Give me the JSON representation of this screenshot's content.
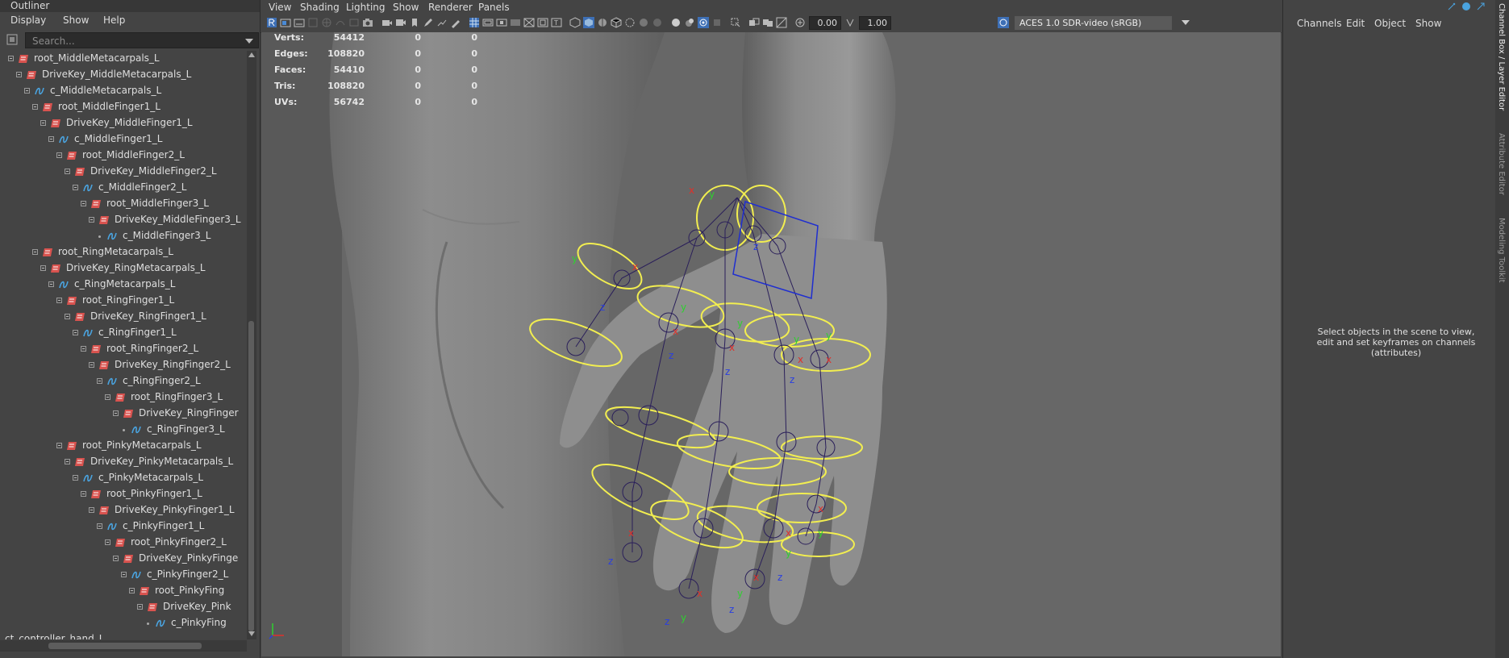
{
  "outliner": {
    "title": "Outliner",
    "menu": [
      "Display",
      "Show",
      "Help"
    ],
    "search_placeholder": "Search...",
    "rows": [
      {
        "label": "root_MiddleMetacarpals_L",
        "indent": 0,
        "type": "root"
      },
      {
        "label": "DriveKey_MiddleMetacarpals_L",
        "indent": 1,
        "type": "root"
      },
      {
        "label": "c_MiddleMetacarpals_L",
        "indent": 2,
        "type": "curve"
      },
      {
        "label": "root_MiddleFinger1_L",
        "indent": 3,
        "type": "root"
      },
      {
        "label": "DriveKey_MiddleFinger1_L",
        "indent": 4,
        "type": "root"
      },
      {
        "label": "c_MiddleFinger1_L",
        "indent": 5,
        "type": "curve"
      },
      {
        "label": "root_MiddleFinger2_L",
        "indent": 6,
        "type": "root"
      },
      {
        "label": "DriveKey_MiddleFinger2_L",
        "indent": 7,
        "type": "root"
      },
      {
        "label": "c_MiddleFinger2_L",
        "indent": 8,
        "type": "curve"
      },
      {
        "label": "root_MiddleFinger3_L",
        "indent": 9,
        "type": "root"
      },
      {
        "label": "DriveKey_MiddleFinger3_L",
        "indent": 10,
        "type": "root"
      },
      {
        "label": "c_MiddleFinger3_L",
        "indent": 11,
        "type": "curve",
        "leaf": true
      },
      {
        "label": "root_RingMetacarpals_L",
        "indent": 3,
        "type": "root"
      },
      {
        "label": "DriveKey_RingMetacarpals_L",
        "indent": 4,
        "type": "root"
      },
      {
        "label": "c_RingMetacarpals_L",
        "indent": 5,
        "type": "curve"
      },
      {
        "label": "root_RingFinger1_L",
        "indent": 6,
        "type": "root"
      },
      {
        "label": "DriveKey_RingFinger1_L",
        "indent": 7,
        "type": "root"
      },
      {
        "label": "c_RingFinger1_L",
        "indent": 8,
        "type": "curve"
      },
      {
        "label": "root_RingFinger2_L",
        "indent": 9,
        "type": "root"
      },
      {
        "label": "DriveKey_RingFinger2_L",
        "indent": 10,
        "type": "root"
      },
      {
        "label": "c_RingFinger2_L",
        "indent": 11,
        "type": "curve"
      },
      {
        "label": "root_RingFinger3_L",
        "indent": 12,
        "type": "root"
      },
      {
        "label": "DriveKey_RingFinger",
        "indent": 13,
        "type": "root"
      },
      {
        "label": "c_RingFinger3_L",
        "indent": 14,
        "type": "curve",
        "leaf": true
      },
      {
        "label": "root_PinkyMetacarpals_L",
        "indent": 6,
        "type": "root"
      },
      {
        "label": "DriveKey_PinkyMetacarpals_L",
        "indent": 7,
        "type": "root"
      },
      {
        "label": "c_PinkyMetacarpals_L",
        "indent": 8,
        "type": "curve"
      },
      {
        "label": "root_PinkyFinger1_L",
        "indent": 9,
        "type": "root"
      },
      {
        "label": "DriveKey_PinkyFinger1_L",
        "indent": 10,
        "type": "root"
      },
      {
        "label": "c_PinkyFinger1_L",
        "indent": 11,
        "type": "curve"
      },
      {
        "label": "root_PinkyFinger2_L",
        "indent": 12,
        "type": "root"
      },
      {
        "label": "DriveKey_PinkyFinge",
        "indent": 13,
        "type": "root"
      },
      {
        "label": "c_PinkyFinger2_L",
        "indent": 14,
        "type": "curve"
      },
      {
        "label": "root_PinkyFing",
        "indent": 15,
        "type": "root"
      },
      {
        "label": "DriveKey_Pink",
        "indent": 16,
        "type": "root"
      },
      {
        "label": "c_PinkyFing",
        "indent": 17,
        "type": "curve",
        "leaf": true
      },
      {
        "label": "ct_controller_hand_L",
        "indent": 0,
        "type": "none"
      }
    ]
  },
  "viewport": {
    "menu": [
      "View",
      "Shading",
      "Lighting",
      "Show",
      "Renderer",
      "Panels"
    ],
    "exposure": "0.00",
    "gamma": "1.00",
    "color_space": "ACES 1.0 SDR-video (sRGB)",
    "hud": [
      {
        "label": "Verts:",
        "v1": "54412",
        "v2": "0",
        "v3": "0"
      },
      {
        "label": "Edges:",
        "v1": "108820",
        "v2": "0",
        "v3": "0"
      },
      {
        "label": "Faces:",
        "v1": "54410",
        "v2": "0",
        "v3": "0"
      },
      {
        "label": "Tris:",
        "v1": "108820",
        "v2": "0",
        "v3": "0"
      },
      {
        "label": "UVs:",
        "v1": "56742",
        "v2": "0",
        "v3": "0"
      }
    ],
    "axis_labels": {
      "x": "x",
      "y": "y",
      "z": "z"
    }
  },
  "channel_box": {
    "menu": [
      "Channels",
      "Edit",
      "Object",
      "Show"
    ],
    "message": "Select objects in the scene to view, edit and set keyframes on channels (attributes)"
  },
  "side_tabs": [
    "Channel Box / Layer Editor",
    "Attribute Editor",
    "Modeling Toolkit"
  ],
  "colors": {
    "root_icon": "#d9534f",
    "curve_icon": "#4aa3df",
    "rig_yellow": "#f5f05a",
    "axis_red": "#e0302a",
    "axis_green": "#2fd02f",
    "axis_blue": "#2a3fe0"
  }
}
